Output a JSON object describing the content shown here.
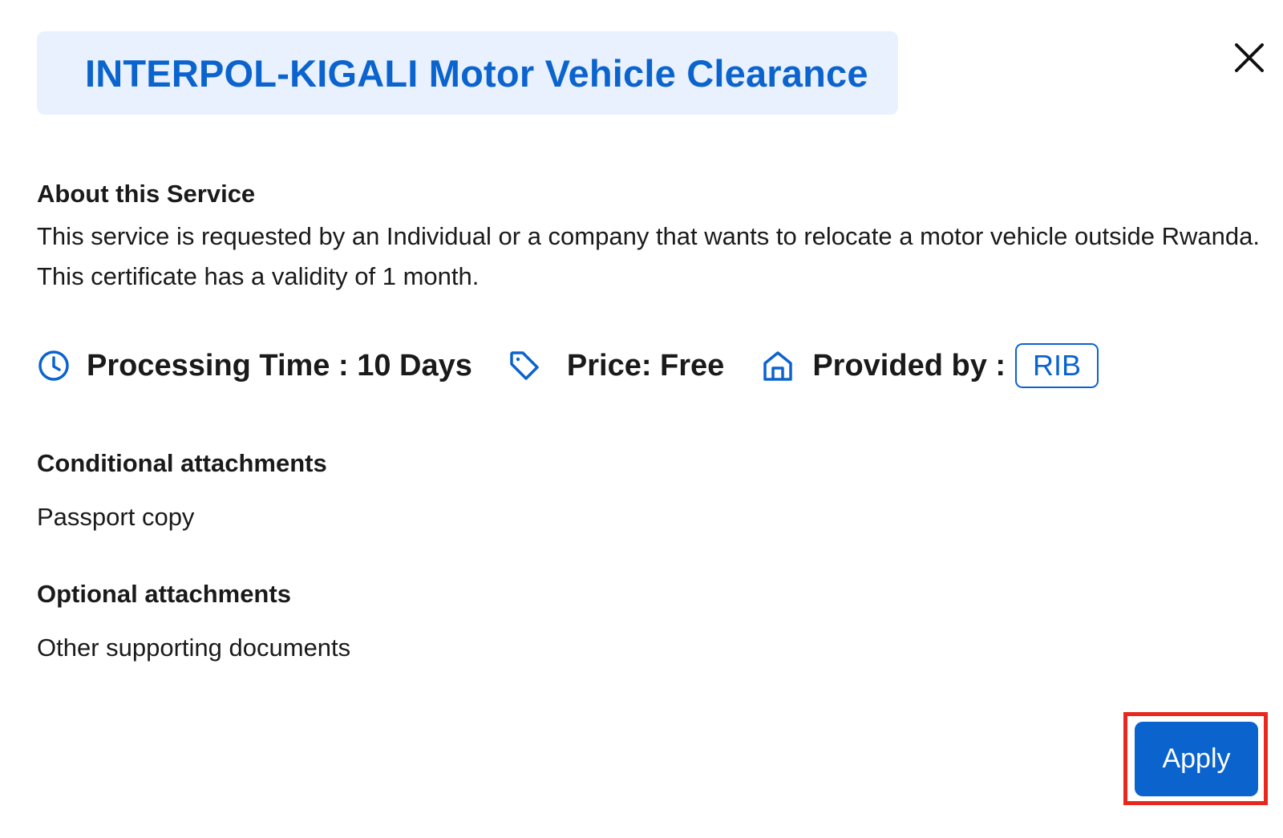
{
  "modal": {
    "title": "INTERPOL-KIGALI Motor Vehicle Clearance",
    "close_icon": "close-icon"
  },
  "about": {
    "heading": "About this Service",
    "body": "This service is requested by an Individual or a company that wants to relocate a motor vehicle outside Rwanda. This certificate has a validity of 1 month."
  },
  "info": {
    "processing_time": "Processing Time : 10 Days",
    "processing_icon": "clock-icon",
    "price": "Price: Free",
    "price_icon": "tag-icon",
    "provided_by": "Provided by :",
    "provider_icon": "home-icon",
    "provider_badge": "RIB"
  },
  "conditional": {
    "heading": "Conditional attachments",
    "items": [
      "Passport copy"
    ]
  },
  "optional": {
    "heading": "Optional attachments",
    "items": [
      "Other supporting documents"
    ]
  },
  "actions": {
    "apply_label": "Apply"
  },
  "colors": {
    "accent": "#0b63ce",
    "title_bg": "#e8f1fd",
    "highlight": "#e8281e"
  }
}
